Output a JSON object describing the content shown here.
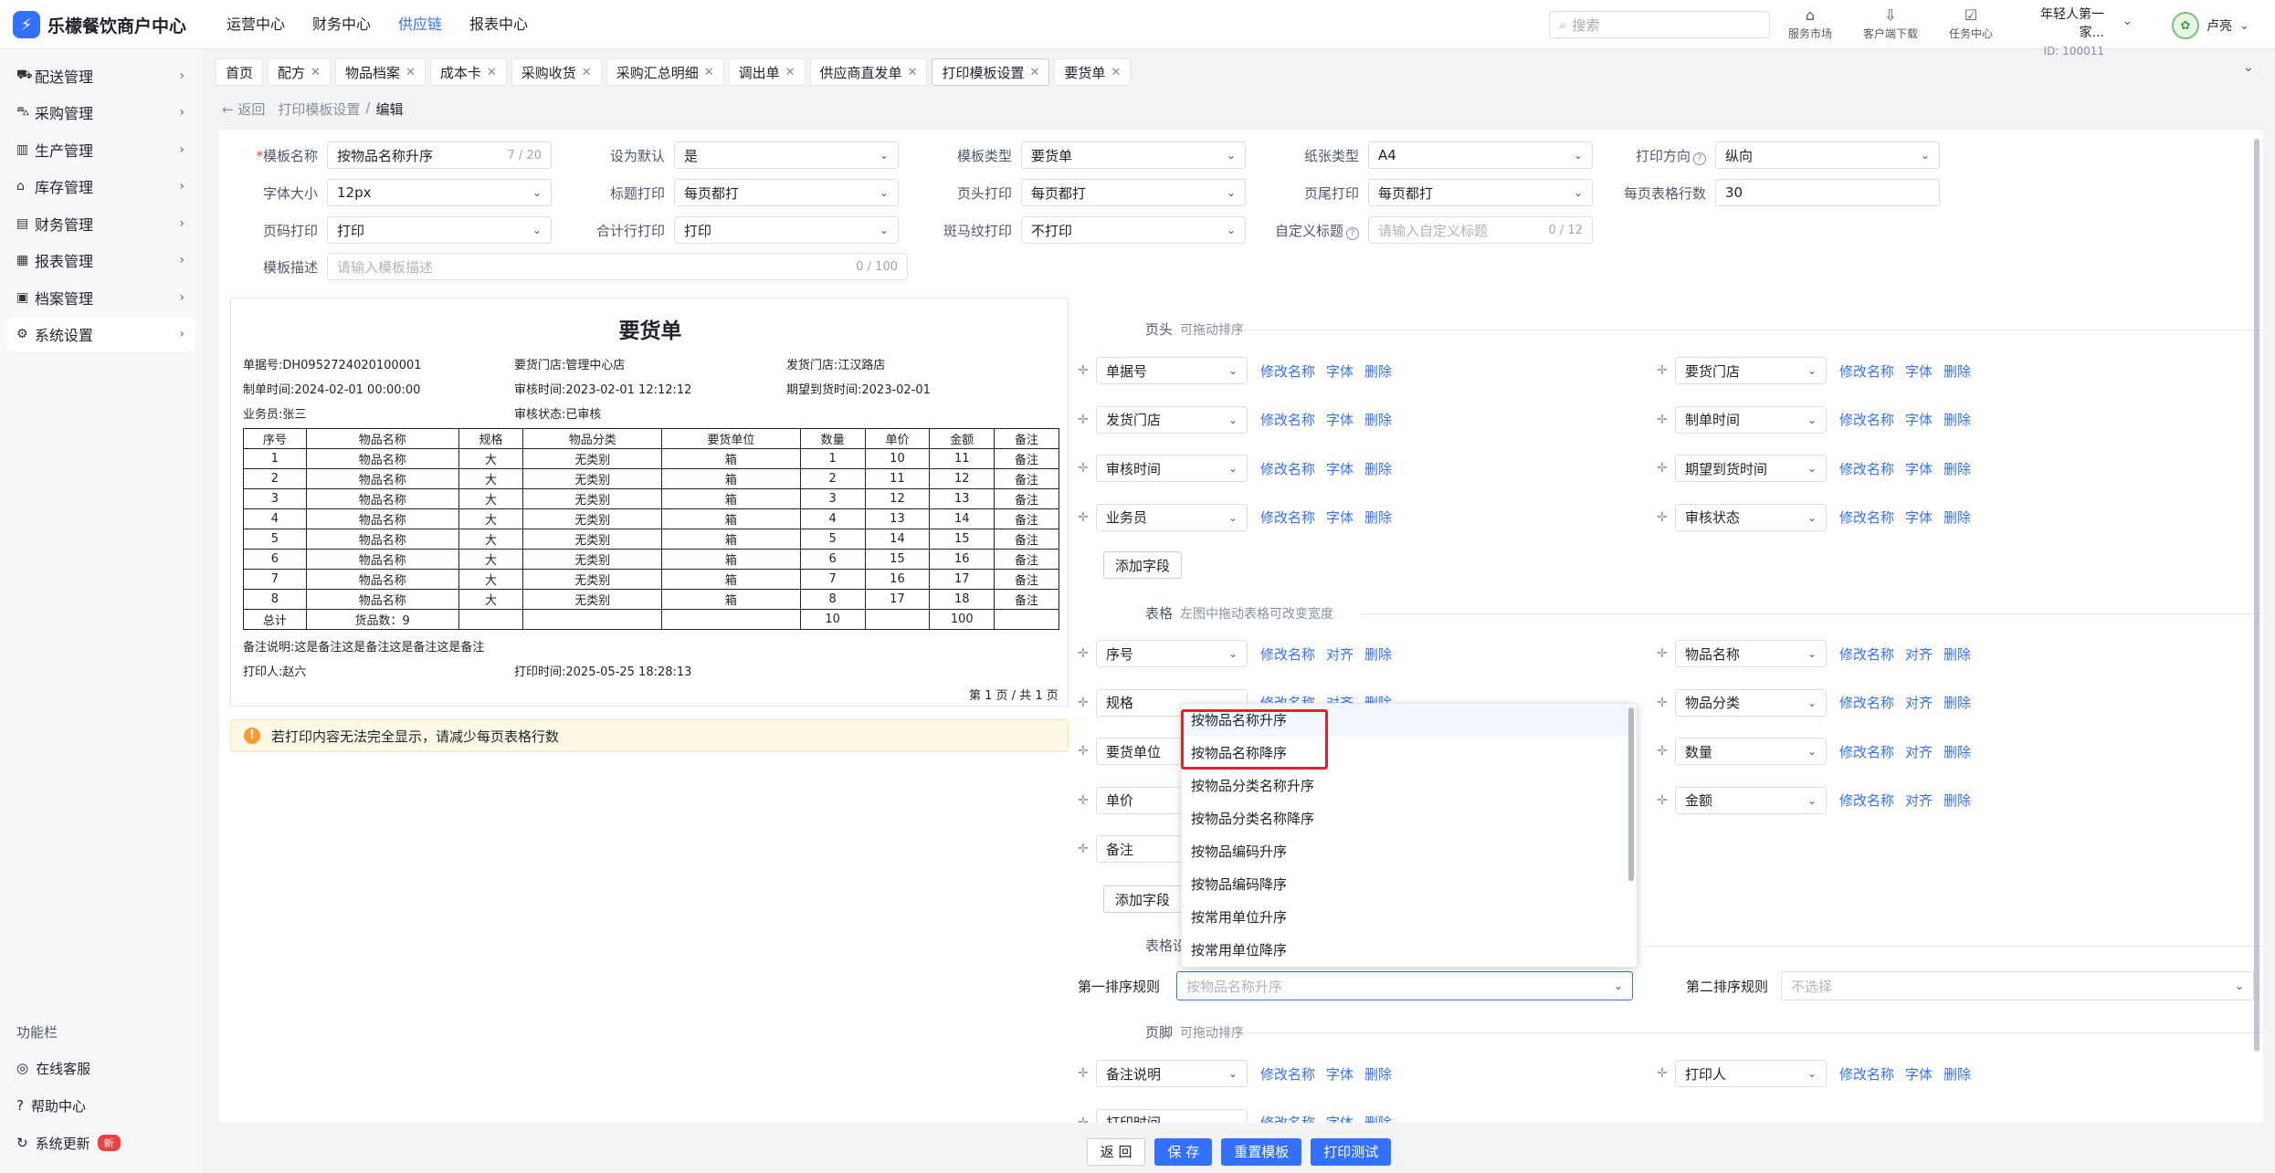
{
  "app": {
    "title": "乐檬餐饮商户中心"
  },
  "topnav": [
    "运营中心",
    "财务中心",
    "供应链",
    "报表中心"
  ],
  "search": {
    "placeholder": "搜索"
  },
  "tools": [
    {
      "label": "服务市场",
      "icon": "shop-icon"
    },
    {
      "label": "客户端下载",
      "icon": "download-icon"
    },
    {
      "label": "任务中心",
      "icon": "task-icon"
    }
  ],
  "account": {
    "name": "年轻人第一家...",
    "id": "ID: 100011"
  },
  "user": {
    "name": "卢亮"
  },
  "sidebar": {
    "items": [
      {
        "label": "配送管理",
        "icon": "truck-icon"
      },
      {
        "label": "采购管理",
        "icon": "cart-icon"
      },
      {
        "label": "生产管理",
        "icon": "chart-icon"
      },
      {
        "label": "库存管理",
        "icon": "warehouse-icon"
      },
      {
        "label": "财务管理",
        "icon": "wallet-icon"
      },
      {
        "label": "报表管理",
        "icon": "report-icon"
      },
      {
        "label": "档案管理",
        "icon": "archive-icon"
      },
      {
        "label": "系统设置",
        "icon": "gear-icon"
      }
    ],
    "func_title": "功能栏",
    "func_items": [
      {
        "label": "在线客服",
        "icon": "service-icon"
      },
      {
        "label": "帮助中心",
        "icon": "help-icon"
      },
      {
        "label": "系统更新",
        "icon": "refresh-icon",
        "badge": "新"
      }
    ]
  },
  "tabs": [
    "首页",
    "配方",
    "物品档案",
    "成本卡",
    "采购收货",
    "采购汇总明细",
    "调出单",
    "供应商直发单",
    "打印模板设置",
    "要货单"
  ],
  "breadcrumb": {
    "back": "返回",
    "parent": "打印模板设置",
    "sep": "/",
    "current": "编辑"
  },
  "form": {
    "template_name": {
      "label": "模板名称",
      "value": "按物品名称升序",
      "count": "7 / 20"
    },
    "default": {
      "label": "设为默认",
      "value": "是"
    },
    "template_type": {
      "label": "模板类型",
      "value": "要货单"
    },
    "paper_type": {
      "label": "纸张类型",
      "value": "A4"
    },
    "print_dir": {
      "label": "打印方向",
      "value": "纵向"
    },
    "font_size": {
      "label": "字体大小",
      "value": "12px"
    },
    "title_print": {
      "label": "标题打印",
      "value": "每页都打"
    },
    "header_print": {
      "label": "页头打印",
      "value": "每页都打"
    },
    "footer_print": {
      "label": "页尾打印",
      "value": "每页都打"
    },
    "rows_per_page": {
      "label": "每页表格行数",
      "value": "30"
    },
    "page_no": {
      "label": "页码打印",
      "value": "打印"
    },
    "total_row": {
      "label": "合计行打印",
      "value": "打印"
    },
    "zebra": {
      "label": "斑马纹打印",
      "value": "不打印"
    },
    "custom_title": {
      "label": "自定义标题",
      "placeholder": "请输入自定义标题",
      "count": "0 / 12"
    },
    "desc": {
      "label": "模板描述",
      "placeholder": "请输入模板描述",
      "count": "0 / 100"
    }
  },
  "preview": {
    "title": "要货单",
    "info": [
      [
        "单据号:DH0952724020100001",
        "要货门店:管理中心店",
        "发货门店:江汉路店"
      ],
      [
        "制单时间:2024-02-01 00:00:00",
        "审核时间:2023-02-01 12:12:12",
        "期望到货时间:2023-02-01"
      ],
      [
        "业务员:张三",
        "审核状态:已审核",
        ""
      ]
    ],
    "columns": [
      "序号",
      "物品名称",
      "规格",
      "物品分类",
      "要货单位",
      "数量",
      "单价",
      "金额",
      "备注"
    ],
    "rows": [
      [
        "1",
        "物品名称",
        "大",
        "无类别",
        "箱",
        "1",
        "10",
        "11",
        "备注"
      ],
      [
        "2",
        "物品名称",
        "大",
        "无类别",
        "箱",
        "2",
        "11",
        "12",
        "备注"
      ],
      [
        "3",
        "物品名称",
        "大",
        "无类别",
        "箱",
        "3",
        "12",
        "13",
        "备注"
      ],
      [
        "4",
        "物品名称",
        "大",
        "无类别",
        "箱",
        "4",
        "13",
        "14",
        "备注"
      ],
      [
        "5",
        "物品名称",
        "大",
        "无类别",
        "箱",
        "5",
        "14",
        "15",
        "备注"
      ],
      [
        "6",
        "物品名称",
        "大",
        "无类别",
        "箱",
        "6",
        "15",
        "16",
        "备注"
      ],
      [
        "7",
        "物品名称",
        "大",
        "无类别",
        "箱",
        "7",
        "16",
        "17",
        "备注"
      ],
      [
        "8",
        "物品名称",
        "大",
        "无类别",
        "箱",
        "8",
        "17",
        "18",
        "备注"
      ]
    ],
    "total_row": [
      "总计",
      "货品数：9",
      "",
      "",
      "",
      "10",
      "",
      "100",
      ""
    ],
    "remark": "备注说明:这是备注这是备注这是备注这是备注",
    "printer": "打印人:赵六",
    "print_time": "打印时间:2025-05-25 18:28:13",
    "page_info": "第 1 页 / 共 1 页"
  },
  "warning": "若打印内容无法完全显示，请减少每页表格行数",
  "header_section": {
    "title": "页头",
    "hint": "可拖动排序",
    "left": [
      "单据号",
      "发货门店",
      "审核时间",
      "业务员"
    ],
    "right": [
      "要货门店",
      "制单时间",
      "期望到货时间",
      "审核状态"
    ],
    "actions": [
      "修改名称",
      "字体",
      "删除"
    ],
    "add": "添加字段"
  },
  "table_section": {
    "title": "表格",
    "hint": "左图中拖动表格可改变宽度",
    "left": [
      "序号",
      "规格",
      "要货单位",
      "单价",
      "备注"
    ],
    "right": [
      "物品名称",
      "物品分类",
      "数量",
      "金额"
    ],
    "actions": [
      "修改名称",
      "对齐",
      "删除"
    ],
    "add": "添加字段",
    "sort_title": "表格设"
  },
  "sort": {
    "first_label": "第一排序规则",
    "first_placeholder": "按物品名称升序",
    "second_label": "第二排序规则",
    "second_placeholder": "不选择",
    "options": [
      "按物品名称升序",
      "按物品名称降序",
      "按物品分类名称升序",
      "按物品分类名称降序",
      "按物品编码升序",
      "按物品编码降序",
      "按常用单位升序",
      "按常用单位降序"
    ]
  },
  "footer_section": {
    "title": "页脚",
    "hint": "可拖动排序",
    "left": [
      "备注说明",
      "打印时间"
    ],
    "right": [
      "打印人"
    ],
    "actions": [
      "修改名称",
      "字体",
      "删除"
    ]
  },
  "bottom_buttons": [
    "返 回",
    "保 存",
    "重置模板",
    "打印测试"
  ]
}
